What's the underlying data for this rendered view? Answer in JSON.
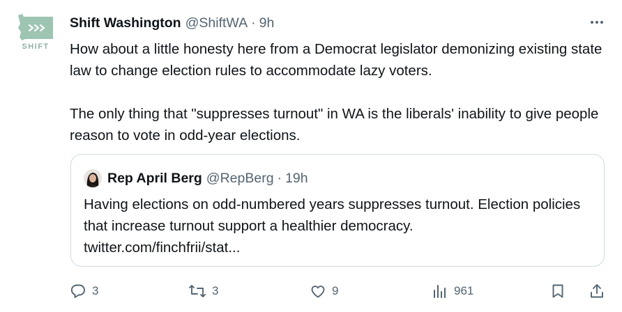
{
  "author": {
    "avatar_label": "SHIFT",
    "name": "Shift Washington",
    "handle": "@ShiftWA",
    "separator": "·",
    "time": "9h"
  },
  "tweet": {
    "paragraphs": [
      "How about a little honesty here from a Democrat legislator demonizing existing state law to change election rules to accommodate lazy voters.",
      "The only thing that \"suppresses turnout\" in WA is the liberals' inability to give people reason to vote in odd-year elections."
    ]
  },
  "quote": {
    "name": "Rep April Berg",
    "handle": "@RepBerg",
    "separator": "·",
    "time": "19h",
    "text": "Having elections on odd-numbered years suppresses turnout. Election policies that increase turnout support a healthier democracy.",
    "link": "twitter.com/finchfrii/stat..."
  },
  "actions": {
    "reply_count": "3",
    "retweet_count": "3",
    "like_count": "9",
    "view_count": "961"
  },
  "icons": {
    "more": "more-icon",
    "reply": "reply-icon",
    "retweet": "retweet-icon",
    "like": "heart-icon",
    "views": "views-icon",
    "bookmark": "bookmark-icon",
    "share": "share-icon"
  },
  "colors": {
    "text": "#0f1419",
    "muted": "#536471",
    "border": "#cfd9de",
    "brand": "#8fb0a2"
  }
}
